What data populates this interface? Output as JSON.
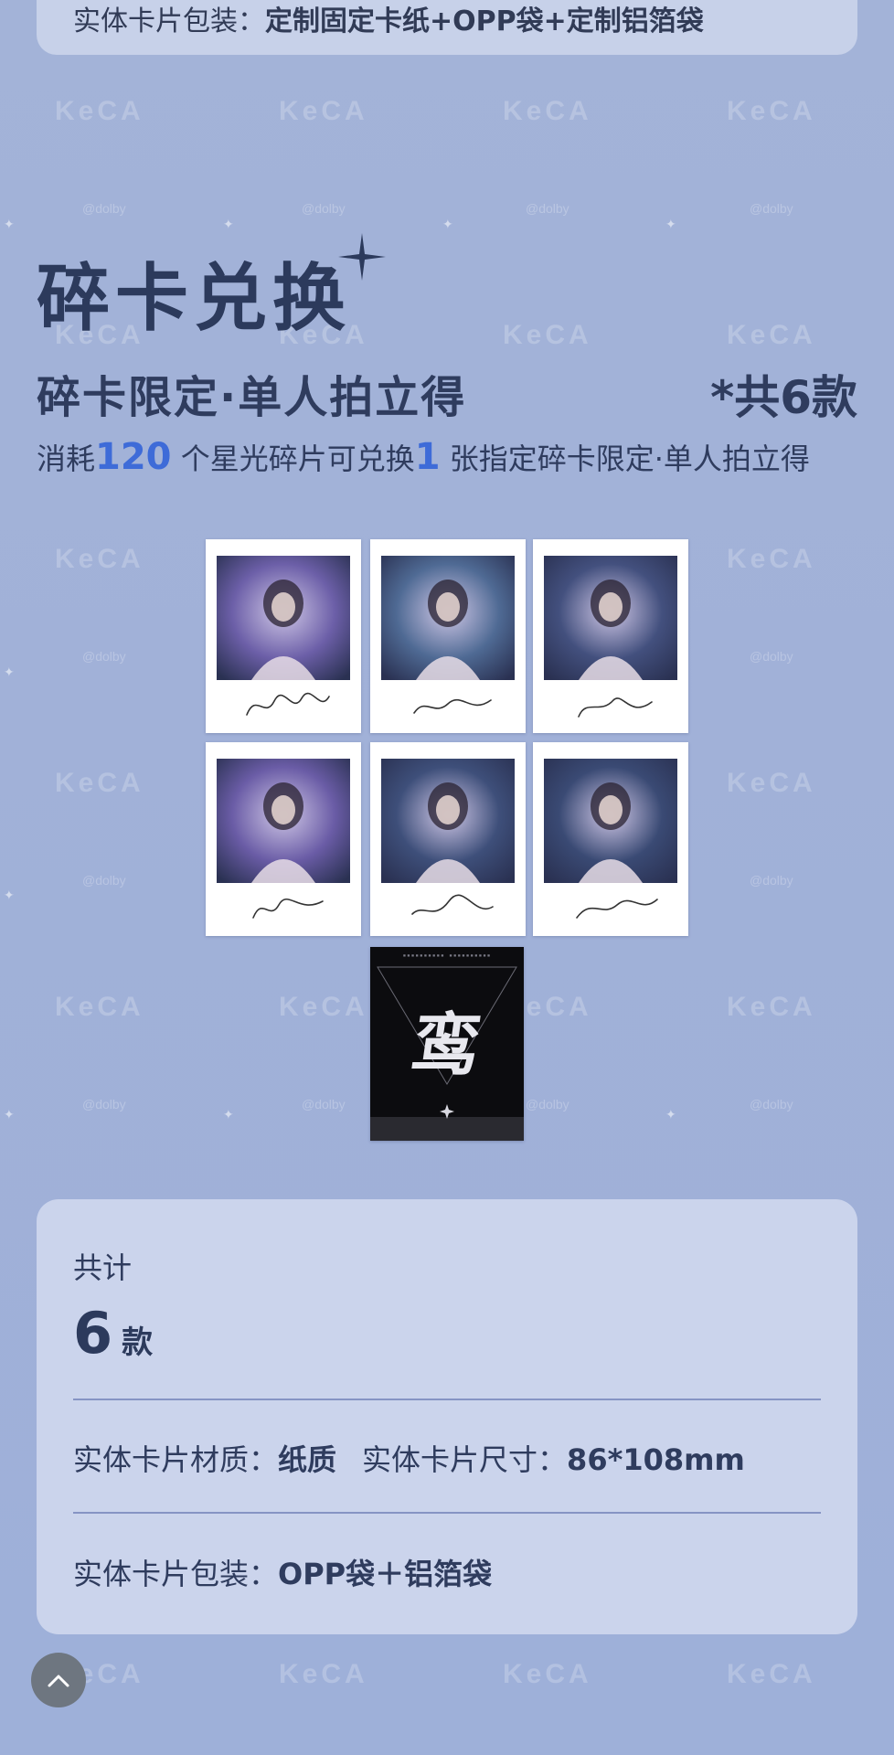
{
  "top_card": {
    "label": "实体卡片包装：",
    "value": "定制固定卡纸+OPP袋+定制铝箔袋"
  },
  "watermark": {
    "brand": "KeCA",
    "handle": "@dolby"
  },
  "section": {
    "title": "碎卡兑换",
    "subtitle": "碎卡限定·单人拍立得",
    "count_note": "*共6款",
    "desc_prefix": "消耗",
    "desc_cost": "120",
    "desc_mid": "个星光碎片可兑换",
    "desc_qty": "1",
    "desc_suffix": "张指定碎卡限定·单人拍立得"
  },
  "photos": [
    {
      "member": "member-1",
      "tint": "#6c5fa8"
    },
    {
      "member": "member-2",
      "tint": "#4f6a94"
    },
    {
      "member": "member-3",
      "tint": "#43507e"
    },
    {
      "member": "member-4",
      "tint": "#6a5ca6"
    },
    {
      "member": "member-5",
      "tint": "#3e4f7a"
    },
    {
      "member": "member-6",
      "tint": "#3a4a74"
    }
  ],
  "back_card": {
    "glyph": "鸾"
  },
  "info": {
    "total_label": "共计",
    "total_count": "6",
    "total_unit": "款",
    "material_label": "实体卡片材质：",
    "material_value": "纸质",
    "size_label": "实体卡片尺寸：",
    "size_value": "86*108mm",
    "packaging_label": "实体卡片包装：",
    "packaging_value": "OPP袋＋铝箔袋"
  },
  "colors": {
    "background": "#a1b1d8",
    "card": "#cbd4ec",
    "accent_number": "#3e6bd8",
    "text": "#2f3c5e"
  },
  "icons": {
    "scroll_top": "chevron-up-icon",
    "sparkle": "sparkle-icon"
  }
}
